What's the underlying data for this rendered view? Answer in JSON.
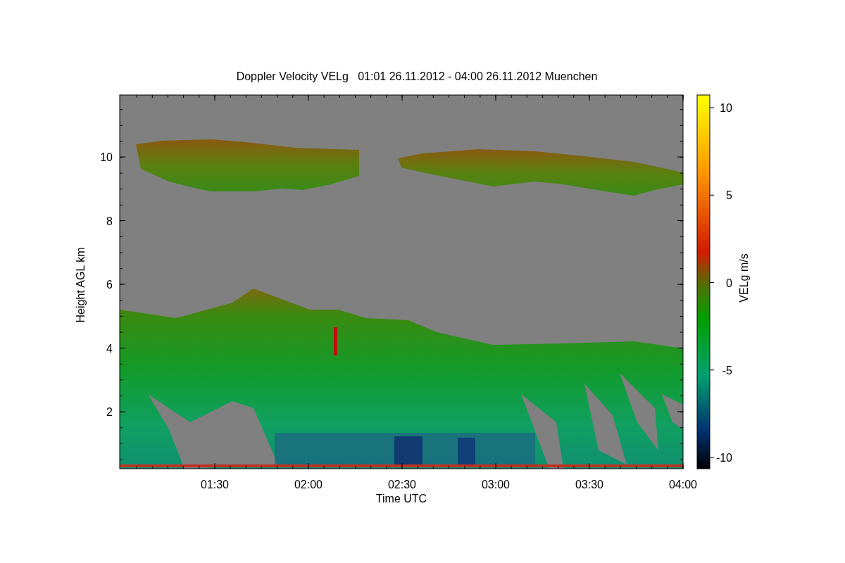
{
  "title": "Doppler Velocity VELg   01:01 26.11.2012 - 04:00 26.11.2012 Muenchen",
  "x_axis": {
    "label": "Time UTC",
    "ticks": [
      "01:30",
      "02:00",
      "02:30",
      "03:00",
      "03:30",
      "04:00"
    ]
  },
  "y_axis": {
    "label": "Height AGL km",
    "ticks": [
      "10",
      "8",
      "6",
      "4",
      "2"
    ]
  },
  "colorbar": {
    "label": "VELg m/s",
    "ticks": [
      "10",
      "5",
      "0",
      "-5",
      "-10"
    ]
  }
}
